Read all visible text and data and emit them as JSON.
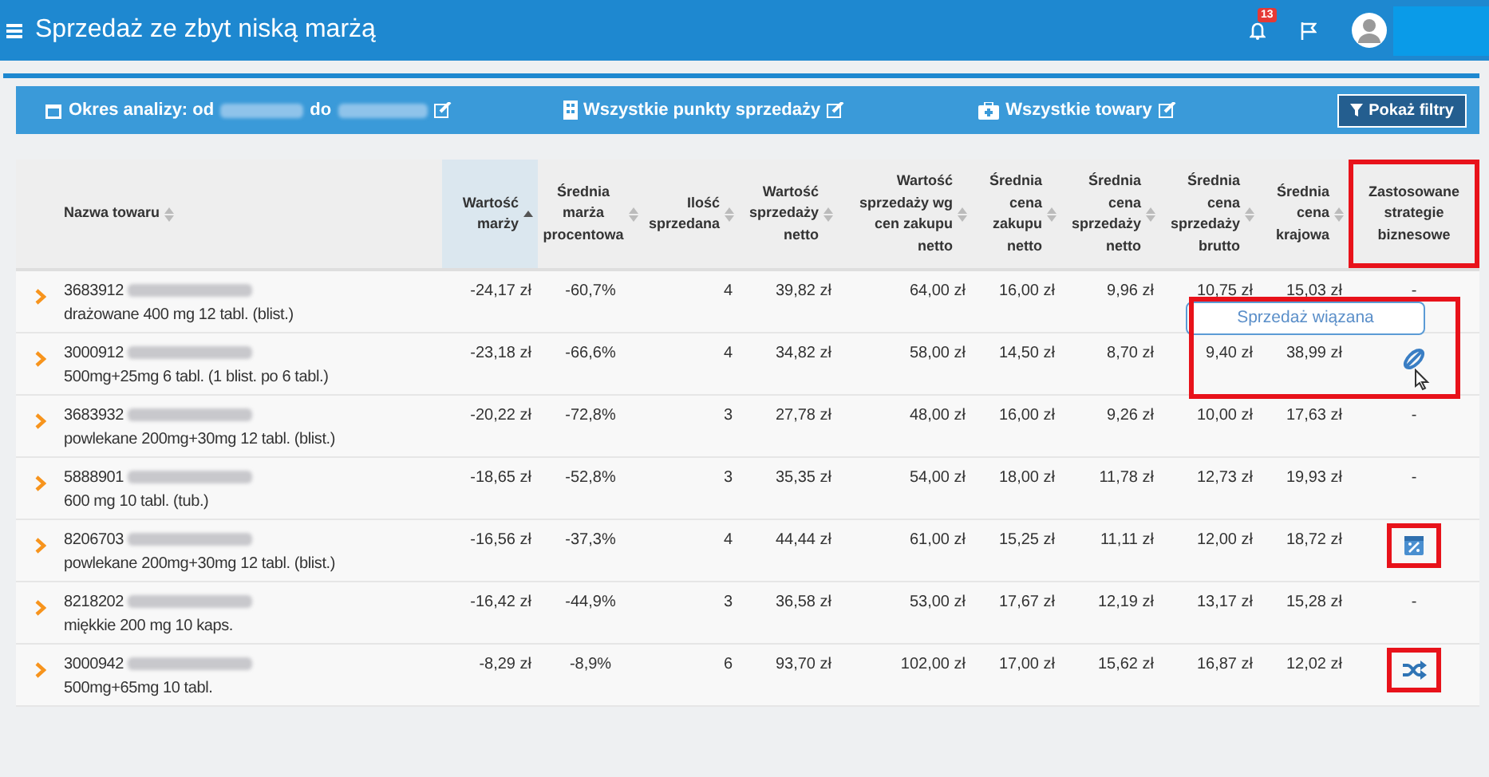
{
  "header": {
    "title": "Sprzedaż ze zbyt niską marżą",
    "notifications": "13"
  },
  "filters": {
    "period_label": "Okres analizy: od",
    "period_to": "do",
    "points": "Wszystkie punkty sprzedaży",
    "products": "Wszystkie towary",
    "button": "Pokaż filtry"
  },
  "table": {
    "name_column": {
      "label": "Nazwa towaru",
      "sortable": true,
      "sorted": false
    },
    "columns": [
      {
        "label": "Wartość marży",
        "sortable": true,
        "sorted": true,
        "highlighted": false
      },
      {
        "label": "Średnia marża procentowa",
        "sortable": true,
        "sorted": false,
        "highlighted": false
      },
      {
        "label": "Ilość sprzedana",
        "sortable": true,
        "sorted": false,
        "highlighted": false
      },
      {
        "label": "Wartość sprzedaży netto",
        "sortable": true,
        "sorted": false,
        "highlighted": false
      },
      {
        "label": "Wartość sprzedaży wg cen zakupu netto",
        "sortable": true,
        "sorted": false,
        "highlighted": false
      },
      {
        "label": "Średnia cena zakupu netto",
        "sortable": true,
        "sorted": false,
        "highlighted": false
      },
      {
        "label": "Średnia cena sprzedaży netto",
        "sortable": true,
        "sorted": false,
        "highlighted": false
      },
      {
        "label": "Średnia cena sprzedaży brutto",
        "sortable": true,
        "sorted": false,
        "highlighted": false
      },
      {
        "label": "Średnia cena krajowa",
        "sortable": true,
        "sorted": false,
        "highlighted": false
      },
      {
        "label": "Zastosowane strategie biznesowe",
        "sortable": false,
        "sorted": false,
        "highlighted": true
      }
    ],
    "rows": [
      {
        "code": "3683912",
        "desc": "drażowane 400 mg 12 tabl. (blist.)",
        "cells": [
          "-24,17 zł",
          "-60,7%",
          "4",
          "39,82 zł",
          "64,00 zł",
          "16,00 zł",
          "9,96 zł",
          "10,75 zł",
          "15,03 zł"
        ],
        "strategy": {
          "kind": "none",
          "text": "-",
          "highlighted": false
        }
      },
      {
        "code": "3000912",
        "desc": "500mg+25mg 6 tabl. (1 blist. po 6 tabl.)",
        "cells": [
          "-23,18 zł",
          "-66,6%",
          "4",
          "34,82 zł",
          "58,00 zł",
          "14,50 zł",
          "8,70 zł",
          "9,40 zł",
          "38,99 zł"
        ],
        "strategy": {
          "kind": "bundle",
          "tooltip": "Sprzedaż wiązana",
          "highlighted": true
        }
      },
      {
        "code": "3683932",
        "desc": "powlekane 200mg+30mg 12 tabl. (blist.)",
        "cells": [
          "-20,22 zł",
          "-72,8%",
          "3",
          "27,78 zł",
          "48,00 zł",
          "16,00 zł",
          "9,26 zł",
          "10,00 zł",
          "17,63 zł"
        ],
        "strategy": {
          "kind": "none",
          "text": "-",
          "highlighted": false
        }
      },
      {
        "code": "5888901",
        "desc": "600 mg 10 tabl. (tub.)",
        "cells": [
          "-18,65 zł",
          "-52,8%",
          "3",
          "35,35 zł",
          "54,00 zł",
          "18,00 zł",
          "11,78 zł",
          "12,73 zł",
          "19,93 zł"
        ],
        "strategy": {
          "kind": "none",
          "text": "-",
          "highlighted": false
        }
      },
      {
        "code": "8206703",
        "desc": "powlekane 200mg+30mg 12 tabl. (blist.)",
        "cells": [
          "-16,56 zł",
          "-37,3%",
          "4",
          "44,44 zł",
          "61,00 zł",
          "15,25 zł",
          "11,11 zł",
          "12,00 zł",
          "18,72 zł"
        ],
        "strategy": {
          "kind": "promo",
          "highlighted": true
        }
      },
      {
        "code": "8218202",
        "desc": "miękkie 200 mg 10 kaps.",
        "cells": [
          "-16,42 zł",
          "-44,9%",
          "3",
          "36,58 zł",
          "53,00 zł",
          "17,67 zł",
          "12,19 zł",
          "13,17 zł",
          "15,28 zł"
        ],
        "strategy": {
          "kind": "none",
          "text": "-",
          "highlighted": false
        }
      },
      {
        "code": "3000942",
        "desc": "500mg+65mg 10 tabl.",
        "cells": [
          "-8,29 zł",
          "-8,9%",
          "6",
          "93,70 zł",
          "102,00 zł",
          "17,00 zł",
          "15,62 zł",
          "16,87 zł",
          "12,02 zł"
        ],
        "strategy": {
          "kind": "shuffle",
          "highlighted": true
        }
      }
    ]
  }
}
